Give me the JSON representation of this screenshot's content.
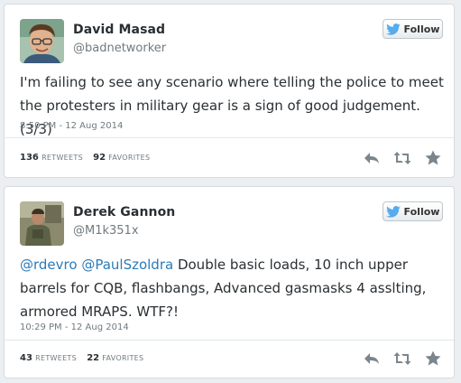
{
  "tweets": [
    {
      "display_name": "David Masad",
      "handle": "@badnetworker",
      "follow_label": "Follow",
      "text_parts": [
        {
          "text": "I'm failing to see any scenario where telling the police to meet the protesters in military gear is a sign of good judgement. (3/3)",
          "type": "text"
        }
      ],
      "timestamp": "8:50 PM - 12 Aug 2014",
      "retweets": "136",
      "retweets_label": "RETWEETS",
      "favorites": "92",
      "favorites_label": "FAVORITES"
    },
    {
      "display_name": "Derek Gannon",
      "handle": "@M1k351x",
      "follow_label": "Follow",
      "text_parts": [
        {
          "text": "@rdevro",
          "type": "mention"
        },
        {
          "text": " ",
          "type": "text"
        },
        {
          "text": "@PaulSzoldra",
          "type": "mention"
        },
        {
          "text": " Double basic loads, 10 inch upper barrels for CQB, flashbangs, Advanced gasmasks 4 asslting, armored MRAPS. WTF?!",
          "type": "text"
        }
      ],
      "timestamp": "10:29 PM - 12 Aug 2014",
      "retweets": "43",
      "retweets_label": "RETWEETS",
      "favorites": "22",
      "favorites_label": "FAVORITES"
    }
  ],
  "icons": {
    "follow": "twitter-bird-icon",
    "reply": "reply-icon",
    "retweet": "retweet-icon",
    "favorite": "star-icon"
  },
  "colors": {
    "link": "#2b7bb9",
    "bird": "#55acee",
    "muted": "#707a80"
  }
}
